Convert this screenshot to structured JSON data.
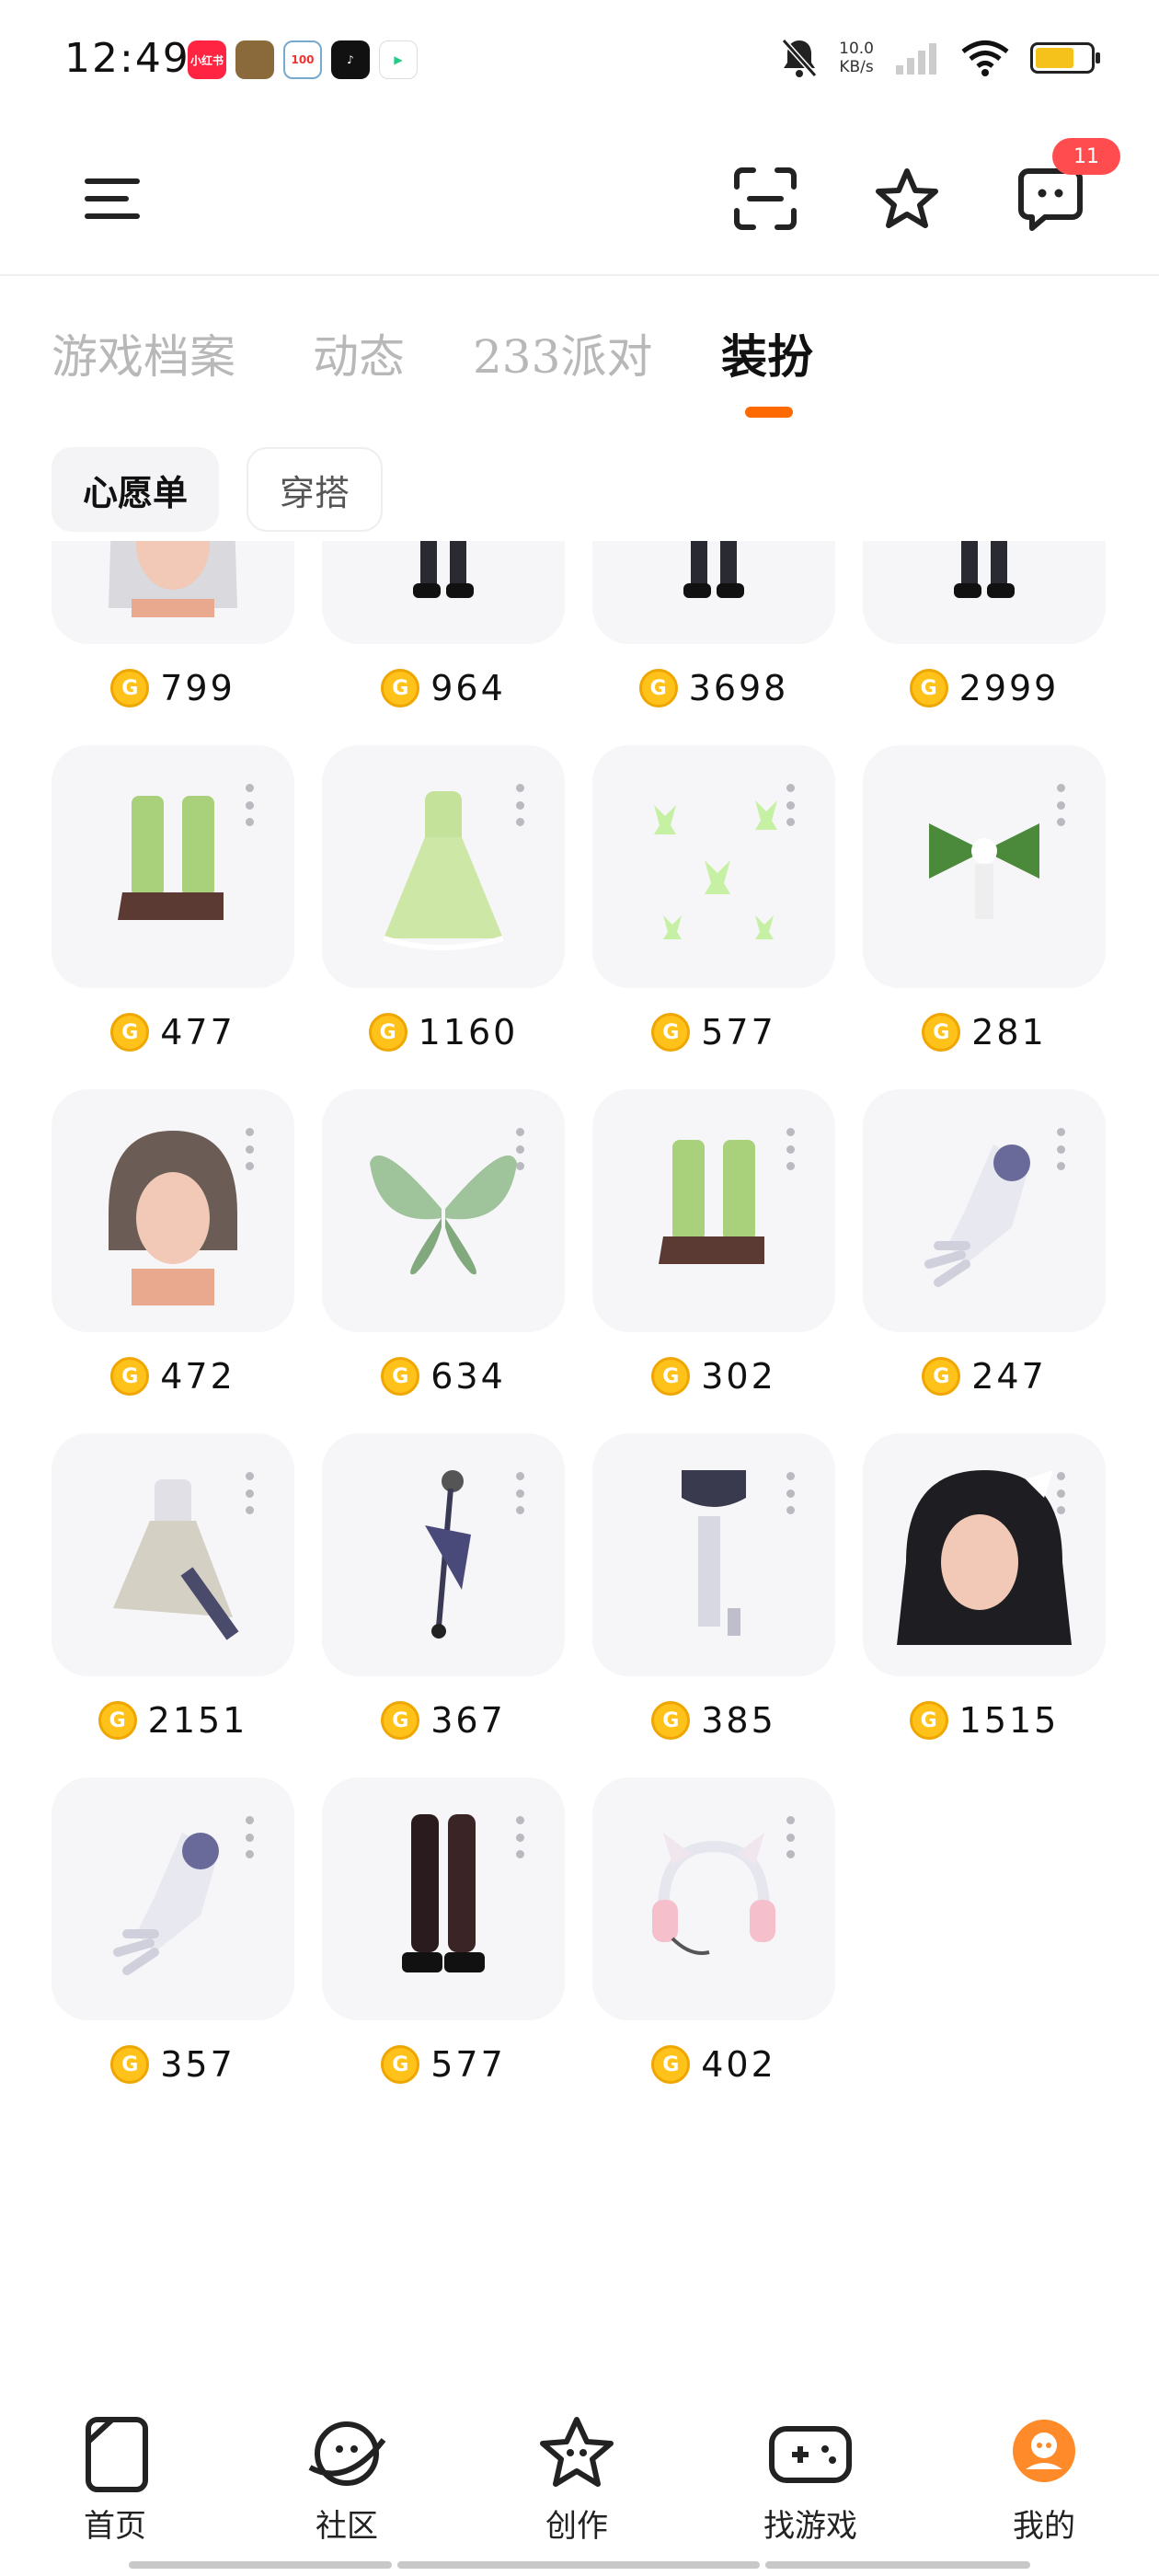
{
  "status_bar": {
    "time": "12:49",
    "net_speed_value": "10.0",
    "net_speed_unit": "KB/s",
    "notification_apps": [
      "xiaohongshu-icon",
      "game-icon",
      "100-icon",
      "tiktok-icon",
      "video-icon"
    ]
  },
  "header": {
    "badge": "11"
  },
  "tabs": [
    {
      "label": "游戏档案",
      "active": false
    },
    {
      "label": "动态",
      "active": false
    },
    {
      "label": "233派对",
      "active": false
    },
    {
      "label": "装扮",
      "active": true
    }
  ],
  "chips": [
    {
      "label": "心愿单",
      "active": true
    },
    {
      "label": "穿搭",
      "active": false
    }
  ],
  "items": [
    {
      "price": "799",
      "icon": "silver-hair-icon"
    },
    {
      "price": "964",
      "icon": "outfit-icon"
    },
    {
      "price": "3698",
      "icon": "outfit-icon"
    },
    {
      "price": "2999",
      "icon": "outfit-icon"
    },
    {
      "price": "477",
      "icon": "boots-icon"
    },
    {
      "price": "1160",
      "icon": "green-dress-icon"
    },
    {
      "price": "577",
      "icon": "butterflies-icon"
    },
    {
      "price": "281",
      "icon": "hair-bow-icon"
    },
    {
      "price": "472",
      "icon": "short-hair-icon"
    },
    {
      "price": "634",
      "icon": "wings-icon"
    },
    {
      "price": "302",
      "icon": "boots-icon"
    },
    {
      "price": "247",
      "icon": "glove-icon"
    },
    {
      "price": "2151",
      "icon": "dress-icon"
    },
    {
      "price": "367",
      "icon": "mic-stand-icon"
    },
    {
      "price": "385",
      "icon": "stockings-icon"
    },
    {
      "price": "1515",
      "icon": "black-hair-icon"
    },
    {
      "price": "357",
      "icon": "glove-icon"
    },
    {
      "price": "577",
      "icon": "thigh-boots-icon"
    },
    {
      "price": "402",
      "icon": "cat-headphones-icon"
    }
  ],
  "bottom_nav": [
    {
      "label": "首页",
      "icon": "home-icon",
      "active": false
    },
    {
      "label": "社区",
      "icon": "planet-icon",
      "active": false
    },
    {
      "label": "创作",
      "icon": "star-icon",
      "active": false
    },
    {
      "label": "找游戏",
      "icon": "gamepad-icon",
      "active": false
    },
    {
      "label": "我的",
      "icon": "profile-icon",
      "active": true
    }
  ],
  "colors": {
    "accent": "#ff6a00",
    "badge": "#ff4d4f",
    "coin": "#ffc21a",
    "thumb_bg": "#f6f5f8"
  }
}
